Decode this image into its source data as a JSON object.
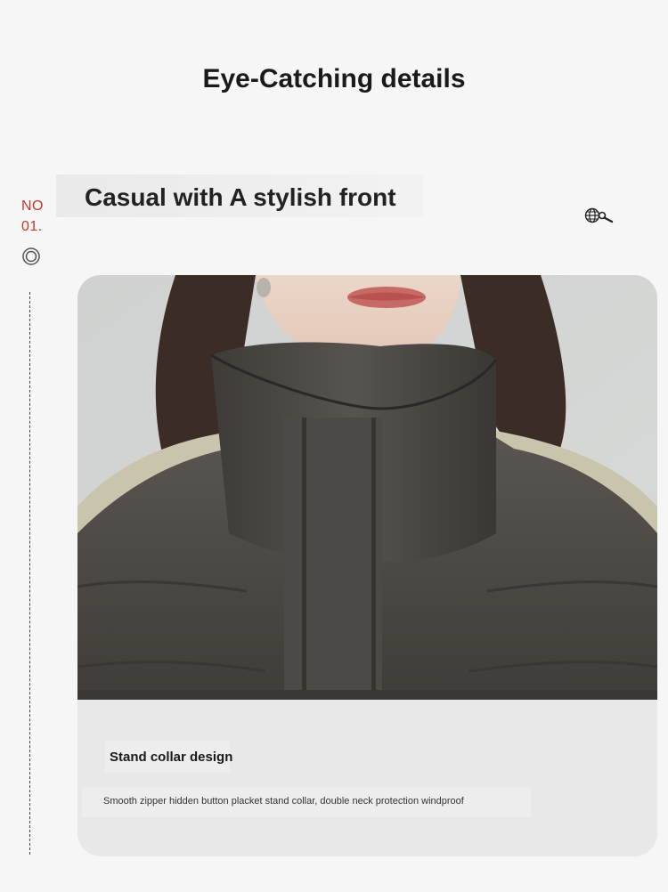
{
  "page": {
    "heading": "Eye-Catching details"
  },
  "section": {
    "number_line1": "NO",
    "number_line2": "01.",
    "subheading": "Casual with A stylish front",
    "icons": [
      "target-icon",
      "globe-search-icon"
    ]
  },
  "card": {
    "image_alt": "Woman wearing dark grey puffer jacket with stand collar",
    "caption_title": "Stand collar design",
    "caption_description": "Smooth zipper hidden button placket stand collar, double neck protection windproof"
  },
  "colors": {
    "background": "#f6f6f6",
    "accent_red": "#c0392b",
    "jacket_grey": "#4d4a47",
    "shoulder_beige": "#c8c2a8",
    "text_dark": "#1a1a1a"
  }
}
